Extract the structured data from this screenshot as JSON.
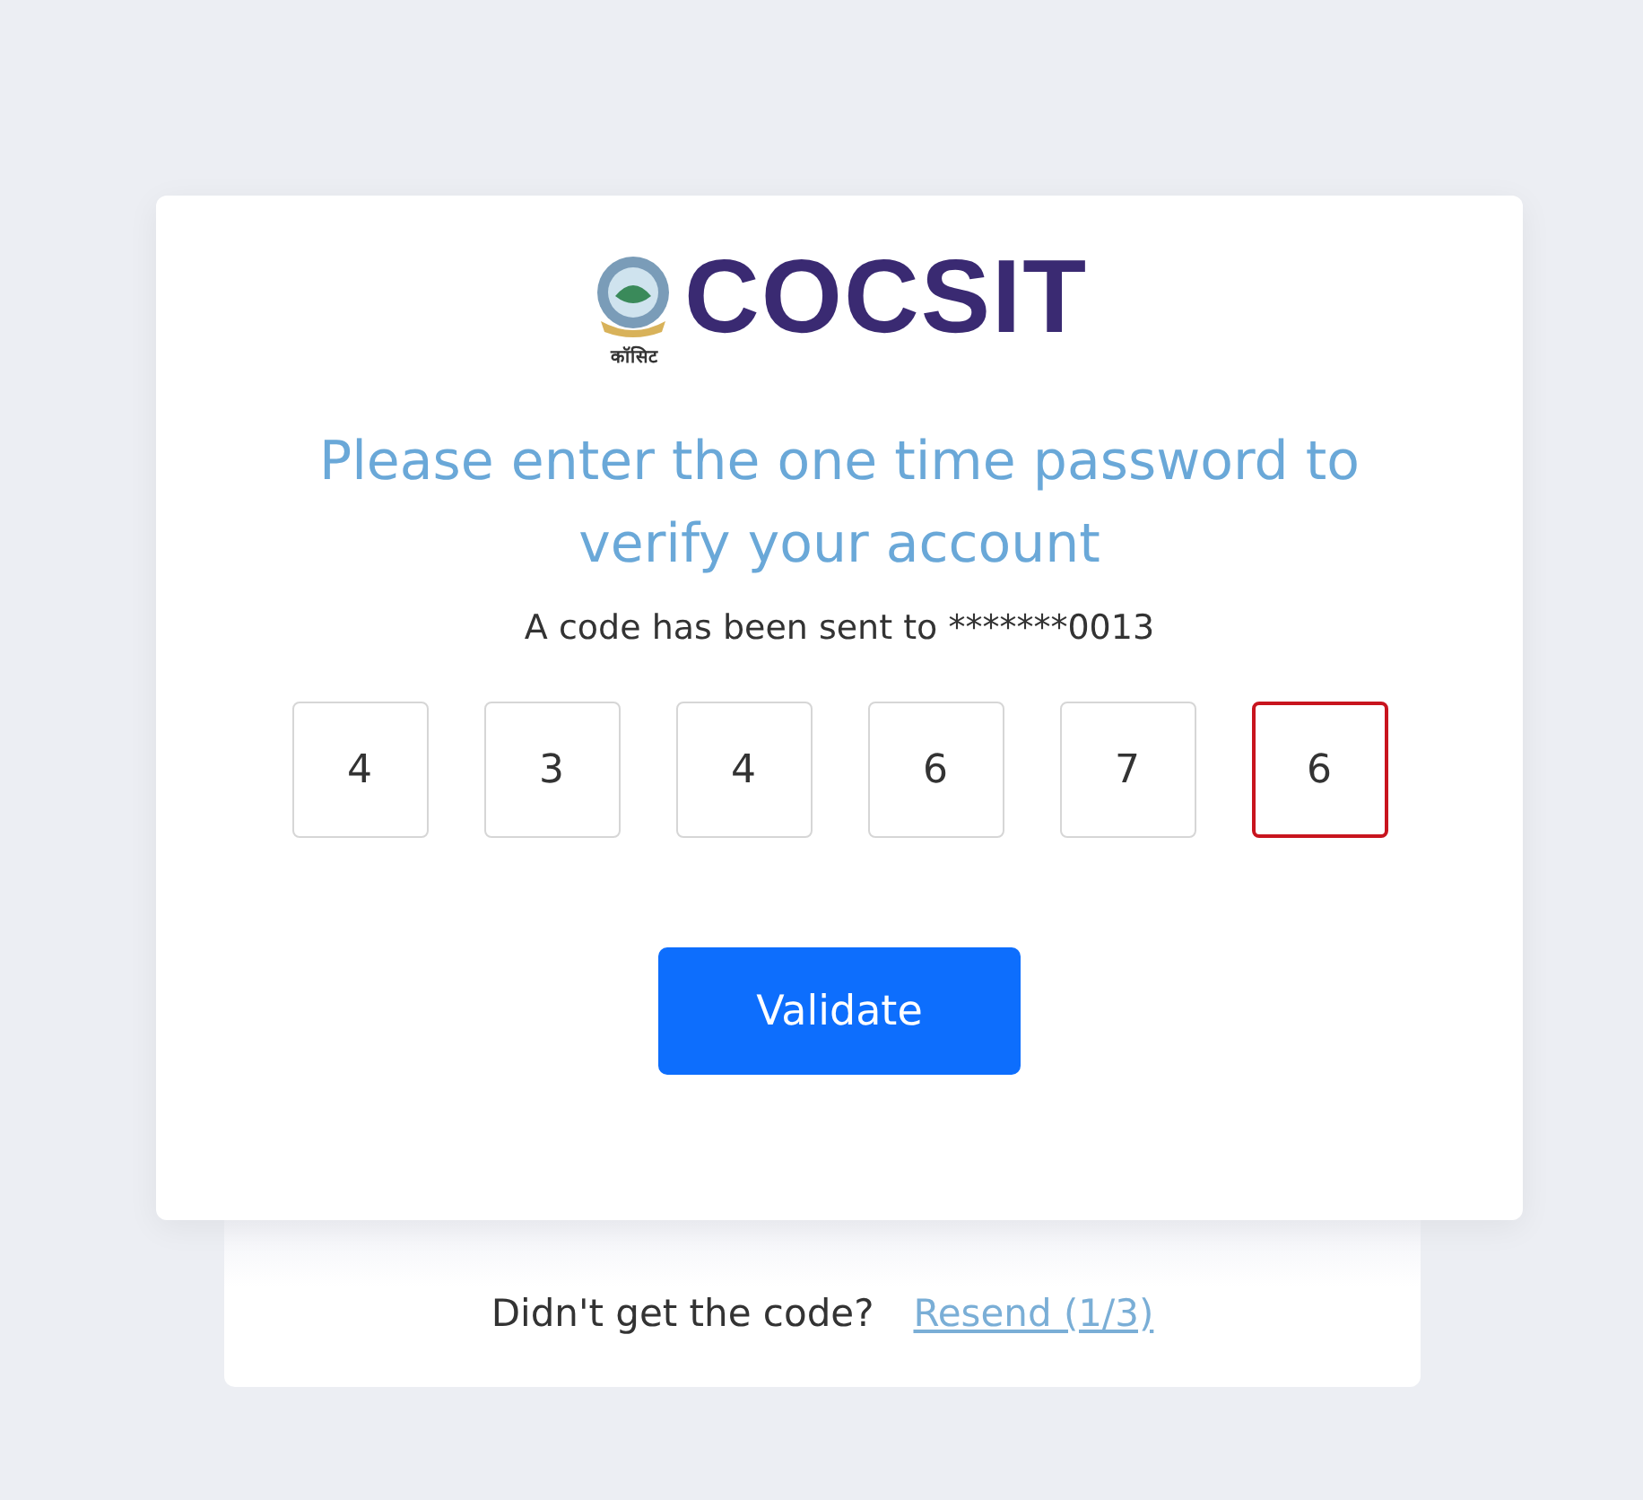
{
  "logo": {
    "name": "COCSIT",
    "subtitle": "कॉसिट"
  },
  "heading": "Please enter the one time password to verify your account",
  "message": "A code has been sent to *******0013",
  "digits": [
    {
      "value": "4",
      "focused": false
    },
    {
      "value": "3",
      "focused": false
    },
    {
      "value": "4",
      "focused": false
    },
    {
      "value": "6",
      "focused": false
    },
    {
      "value": "7",
      "focused": false
    },
    {
      "value": "6",
      "focused": true
    }
  ],
  "button": "Validate",
  "footer": {
    "question": "Didn't get the code?",
    "link": "Resend (1/3)"
  }
}
